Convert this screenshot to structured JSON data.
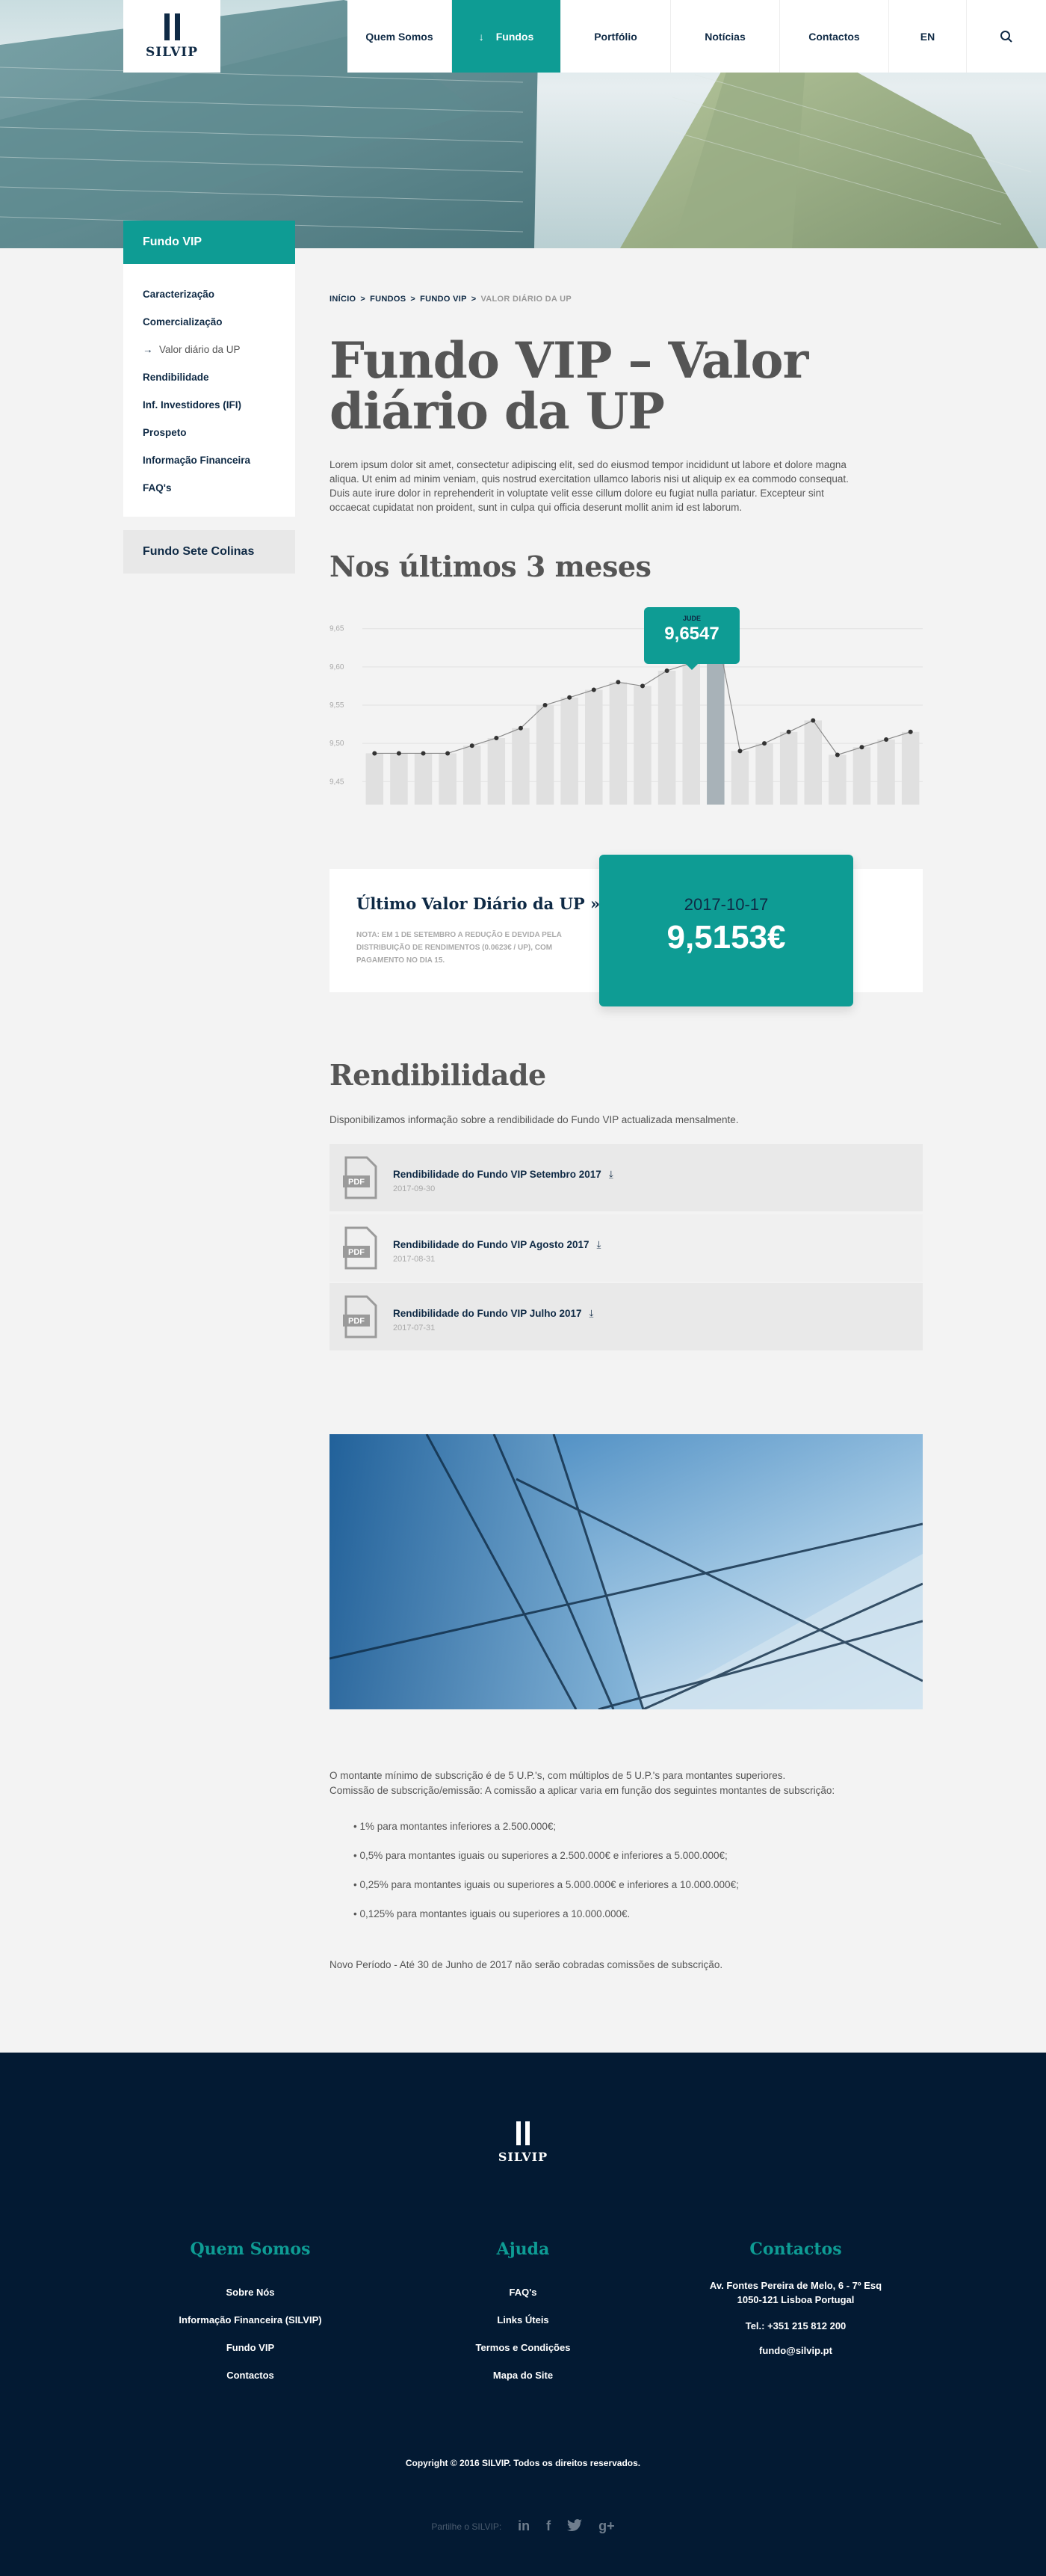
{
  "brand": {
    "name": "SILVIP"
  },
  "nav": {
    "items": [
      "Quem Somos",
      "Fundos",
      "Portfólio",
      "Notícias",
      "Contactos",
      "EN"
    ],
    "active_arrow": "↓",
    "active": "Fundos"
  },
  "sidebar": {
    "title": "Fundo VIP",
    "items": [
      {
        "label": "Caracterização"
      },
      {
        "label": "Comercialização"
      },
      {
        "label": "Valor diário da UP",
        "current": true
      },
      {
        "label": "Rendibilidade"
      },
      {
        "label": "Inf. Investidores (IFI)"
      },
      {
        "label": "Prospeto"
      },
      {
        "label": "Informação Financeira"
      },
      {
        "label": "FAQ's"
      }
    ],
    "current_arrow": "→",
    "other": "Fundo Sete Colinas"
  },
  "breadcrumb": [
    "INÍCIO",
    "FUNDOS",
    "FUNDO VIP",
    "VALOR DIÁRIO DA UP"
  ],
  "breadcrumb_sep": ">",
  "page": {
    "title": "Fundo VIP – Valor diário da UP",
    "intro": "Lorem ipsum dolor sit amet, consectetur adipiscing elit, sed do eiusmod tempor incididunt ut labore et dolore magna aliqua. Ut enim ad minim veniam, quis nostrud exercitation ullamco laboris nisi ut aliquip ex ea commodo consequat. Duis aute irure dolor in reprehenderit in voluptate velit esse cillum dolore eu fugiat nulla pariatur. Excepteur sint occaecat cupidatat non proident, sunt in culpa qui officia deserunt mollit anim id est laborum."
  },
  "chart_section": {
    "title": "Nos últimos 3 meses",
    "tooltip_label": "JUDE",
    "tooltip_value": "9,6547"
  },
  "chart_data": {
    "type": "bar",
    "title": "",
    "xlabel": "",
    "ylabel": "",
    "ylim": [
      9.42,
      9.68
    ],
    "y_ticks": [
      "9,45",
      "9,50",
      "9,55",
      "9,60",
      "9,65"
    ],
    "grid": true,
    "highlight_index": 14,
    "values": [
      9.487,
      9.487,
      9.487,
      9.487,
      9.497,
      9.507,
      9.52,
      9.55,
      9.56,
      9.57,
      9.58,
      9.575,
      9.595,
      9.605,
      9.655,
      9.49,
      9.5,
      9.515,
      9.53,
      9.485,
      9.495,
      9.505,
      9.515
    ]
  },
  "last_value": {
    "title": "Último Valor Diário da UP »",
    "note": "NOTA: EM 1 DE SETEMBRO A REDUÇÃO E DEVIDA PELA DISTRIBUIÇÃO DE RENDIMENTOS (0.0623€ / UP), COM PAGAMENTO NO DIA 15.",
    "date": "2017-10-17",
    "value": "9,5153€"
  },
  "rendibilidade": {
    "title": "Rendibilidade",
    "description": "Disponibilizamos informação sobre a rendibilidade do Fundo VIP actualizada mensalmente.",
    "documents": [
      {
        "title": "Rendibilidade do Fundo VIP Setembro 2017",
        "date": "2017-09-30"
      },
      {
        "title": "Rendibilidade do Fundo VIP Agosto 2017",
        "date": "2017-08-31"
      },
      {
        "title": "Rendibilidade do Fundo VIP Julho 2017",
        "date": "2017-07-31"
      }
    ],
    "download_glyph": "⤓",
    "pdf_label": "PDF"
  },
  "subscription": {
    "line1": "O montante mínimo de subscrição é de 5 U.P.'s, com múltiplos de 5 U.P.'s para montantes superiores.",
    "line2": "Comissão de subscrição/emissão: A comissão a aplicar varia em função dos seguintes montantes de subscrição:",
    "bullets": [
      "• 1% para montantes inferiores a 2.500.000€;",
      "• 0,5% para montantes iguais ou superiores a 2.500.000€ e inferiores a 5.000.000€;",
      "• 0,25% para montantes iguais ou superiores a 5.000.000€ e inferiores a 10.000.000€;",
      "• 0,125% para montantes iguais ou superiores a 10.000.000€."
    ],
    "novo": "Novo Período - Até 30 de Junho de 2017 não serão cobradas comissões de subscrição."
  },
  "footer": {
    "brand": "SILVIP",
    "cols": [
      {
        "title": "Quem Somos",
        "links": [
          "Sobre Nós",
          "Informação Financeira (SILVIP)",
          "Fundo VIP",
          "Contactos"
        ]
      },
      {
        "title": "Ajuda",
        "links": [
          "FAQ's",
          "Links Úteis",
          "Termos e Condições",
          "Mapa do Site"
        ]
      },
      {
        "title": "Contactos",
        "address1": "Av. Fontes Pereira de Melo, 6 - 7º Esq",
        "address2": "1050-121 Lisboa Portugal",
        "phone": "Tel.: +351 215 812 200",
        "email": "fundo@silvip.pt"
      }
    ],
    "copyright": "Copyright © 2016 SILVIP. Todos os direitos reservados.",
    "share_label": "Partilhe o SILVIP:",
    "share_icons": [
      "in",
      "f",
      "twitter-bird",
      "g+"
    ]
  },
  "colors": {
    "accent": "#0e9c94",
    "navy": "#0f2a45",
    "footer": "#031a33"
  }
}
